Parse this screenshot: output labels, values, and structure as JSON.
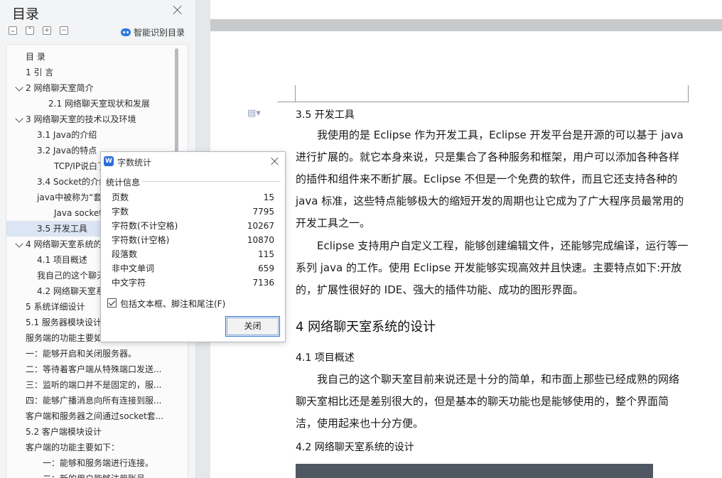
{
  "toc": {
    "title": "目录",
    "smart_toc_label": "智能识别目录",
    "toolbar_icons": [
      "collapse-all-icon",
      "expand-all-icon",
      "add-level-icon",
      "remove-level-icon"
    ],
    "items": [
      {
        "label": "目  录"
      },
      {
        "label": "1 引 言"
      },
      {
        "label": "2  网络聊天室简介"
      },
      {
        "label": "2.1  网络聊天室现状和发展"
      },
      {
        "label": "3 网络聊天室的技术以及环境"
      },
      {
        "label": "3.1 Java的介绍"
      },
      {
        "label": "3.2 Java的特点"
      },
      {
        "label": "TCP/IP说白了就是..."
      },
      {
        "label": "3.4 Socket的介绍"
      },
      {
        "label": "java中被称为“套接字”..."
      },
      {
        "label": "Java socket通信..."
      },
      {
        "label": "3.5  开发工具"
      },
      {
        "label": "4  网络聊天室系统的设计"
      },
      {
        "label": "4.1  项目概述"
      },
      {
        "label": "我自己的这个聊天室..."
      },
      {
        "label": "4.2  网络聊天室系统的设计"
      },
      {
        "label": "5  系统详细设计"
      },
      {
        "label": "5.1  服务器模块设计"
      },
      {
        "label": "服务端的功能主要如下："
      },
      {
        "label": "一：能够开启和关闭服务器。"
      },
      {
        "label": "二：等待着客户端从特殊端口发送..."
      },
      {
        "label": "三：监听的端口并不是固定的，服..."
      },
      {
        "label": "四：能够广播消息向所有连接到服..."
      },
      {
        "label": "客户端和服务器之间通过socket套..."
      },
      {
        "label": "5.2  客户端模块设计"
      },
      {
        "label": "客户端的功能主要如下："
      },
      {
        "label": "一：能够和服务端进行连接。"
      },
      {
        "label": "二：新的用户能够注册账号..."
      }
    ]
  },
  "dialog": {
    "title": "字数统计",
    "section": "统计信息",
    "stats": [
      {
        "label": "页数",
        "value": "15"
      },
      {
        "label": "字数",
        "value": "7795"
      },
      {
        "label": "字符数(不计空格)",
        "value": "10267"
      },
      {
        "label": "字符数(计空格)",
        "value": "10870"
      },
      {
        "label": "段落数",
        "value": "115"
      },
      {
        "label": "非中文单词",
        "value": "659"
      },
      {
        "label": "中文字符",
        "value": "7136"
      }
    ],
    "checkbox_label": "包括文本框、脚注和尾注(F)",
    "checkbox_checked": true,
    "close_button": "关闭"
  },
  "document": {
    "h_3_5": "3.5  开发工具",
    "p1": "我使用的是 Eclipse 作为开发工具，Eclipse 开发平台是开源的可以基于 java 进行扩展的。就它本身来说，只是集合了各种服务和框架，用户可以添加各种各样的插件和组件来不断扩展。Eclipse 不但是一个免费的软件，而且它还支持各种的 java 标准，这些特点能够极大的缩短开发的周期也让它成为了广大程序员最常用的开发工具之一。",
    "p2": "Eclipse 支持用户自定义工程，能够创建编辑文件，还能够完成编译，运行等一系列 java 的工作。使用 Eclipse 开发能够实现高效并且快速。主要特点如下:开放的，扩展性很好的 IDE、强大的插件功能、成功的图形界面。",
    "h_4": "4  网络聊天室系统的设计",
    "h_4_1": "4.1  项目概述",
    "p3": "我自己的这个聊天室目前来说还是十分的简单，和市面上那些已经成熟的网络聊天室相比还是差别很大的，但是基本的聊天功能也是能够使用的，整个界面简洁，使用起来也十分方便。",
    "h_4_2": "4.2  网络聊天室系统的设计"
  }
}
